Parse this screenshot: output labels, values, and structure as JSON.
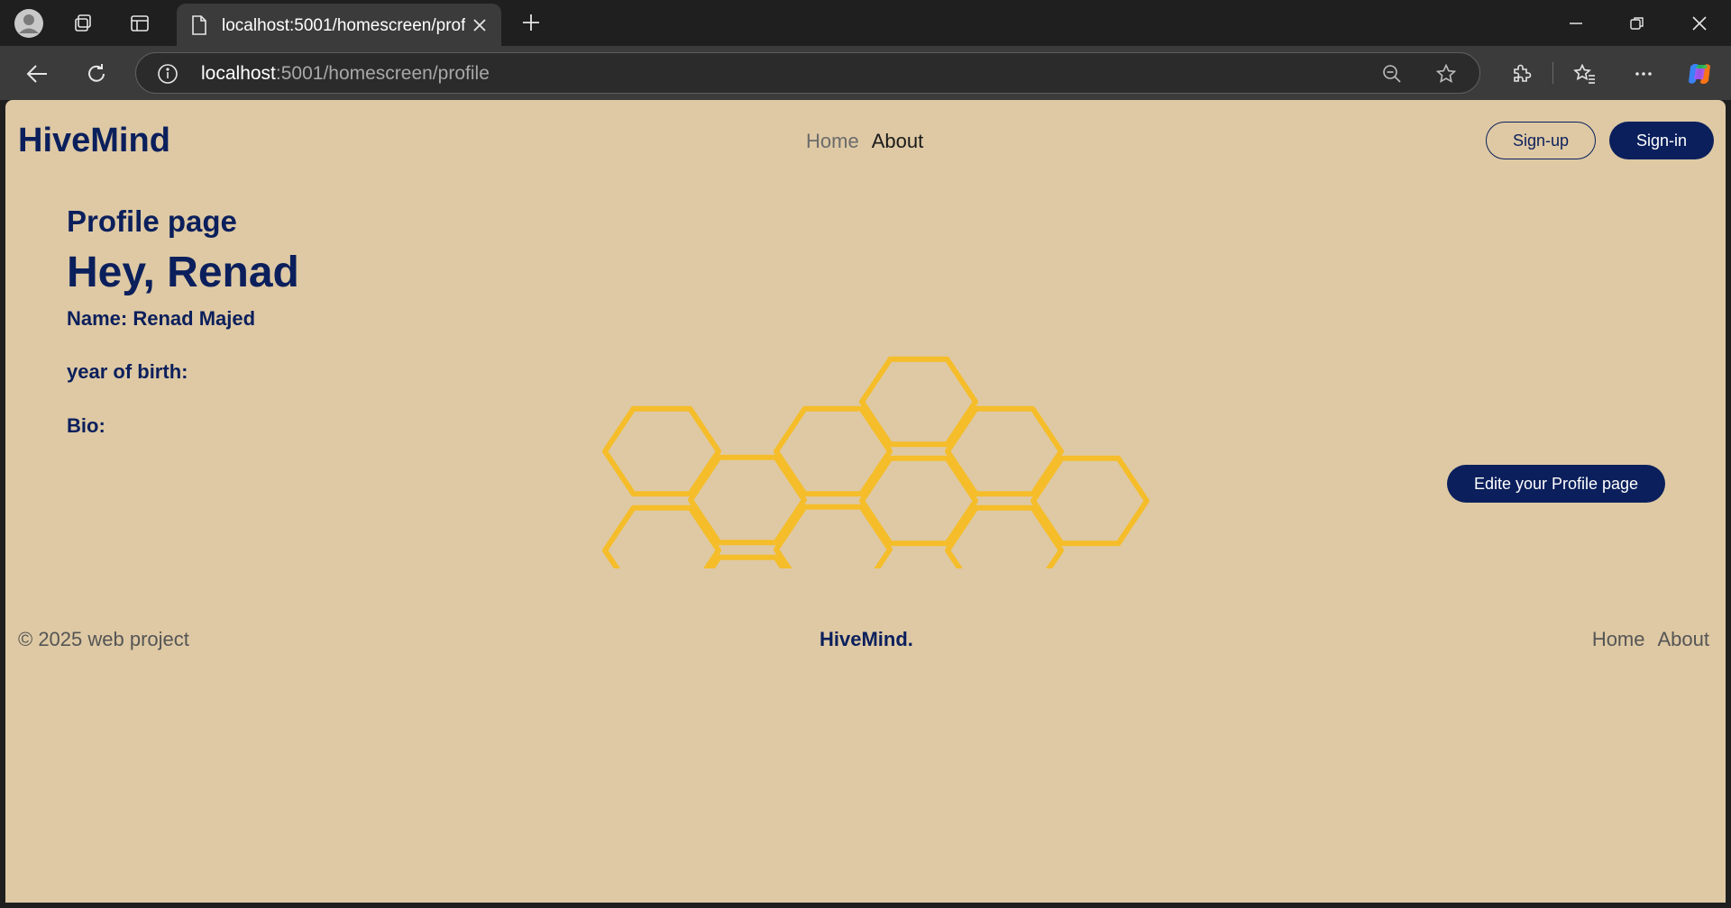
{
  "browser": {
    "tab_title": "localhost:5001/homescreen/profile",
    "url_host": "localhost",
    "url_path": ":5001/homescreen/profile",
    "icons": [
      "profile-avatar-icon",
      "workspaces-icon",
      "tab-actions-icon",
      "page-icon",
      "close-tab-icon",
      "new-tab-icon",
      "minimize-icon",
      "restore-icon",
      "close-window-icon",
      "back-icon",
      "refresh-icon",
      "site-info-icon",
      "zoom-out-icon",
      "favorite-star-icon",
      "extensions-icon",
      "favorites-icon",
      "more-icon",
      "copilot-icon"
    ]
  },
  "page": {
    "brand": "HiveMind",
    "nav": [
      "Home",
      "About"
    ],
    "signup_label": "Sign-up",
    "signin_label": "Sign-in",
    "profile_heading": "Profile page",
    "greeting": "Hey, Renad",
    "name_line": "Name: Renad Majed",
    "birth_line": "year of birth:",
    "bio_line": "Bio:",
    "edit_label": "Edite your Profile page",
    "footer": {
      "copyright": "© 2025 web project",
      "brand": "HiveMind.",
      "nav": [
        "Home",
        "About"
      ]
    }
  },
  "colors": {
    "page_bg": "#dec9a4",
    "navy": "#0b1f5c",
    "honeycomb": "#f5bd2a"
  }
}
